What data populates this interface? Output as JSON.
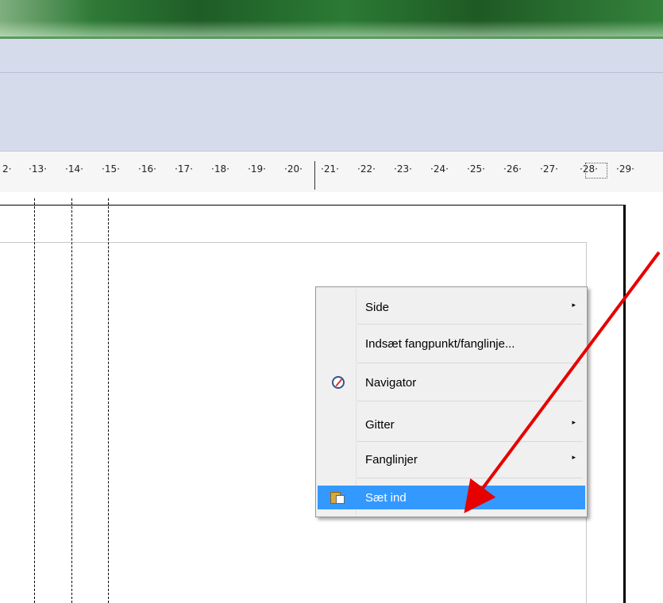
{
  "ruler": {
    "labels": [
      "2·",
      "·13·",
      "·14·",
      "·15·",
      "·16·",
      "·17·",
      "·18·",
      "·19·",
      "·20·",
      "·21·",
      "·22·",
      "·23·",
      "·24·",
      "·25·",
      "·26·",
      "·27·",
      "·28·",
      "·29·"
    ]
  },
  "context_menu": {
    "items": [
      {
        "label": "Side",
        "submenu": true
      },
      {
        "label": "Indsæt fangpunkt/fanglinje...",
        "submenu": false
      },
      {
        "label": "Navigator",
        "icon": "navigator-icon",
        "submenu": false
      },
      {
        "label": "Gitter",
        "submenu": true
      },
      {
        "label": "Fanglinjer",
        "submenu": true
      },
      {
        "label": "Sæt ind",
        "icon": "paste-icon",
        "submenu": false,
        "highlighted": true
      }
    ],
    "submenu_arrow": "▸"
  },
  "colors": {
    "highlight": "#3399ff",
    "annotation_arrow": "#e60000",
    "toolbar": "#d6dbec"
  }
}
